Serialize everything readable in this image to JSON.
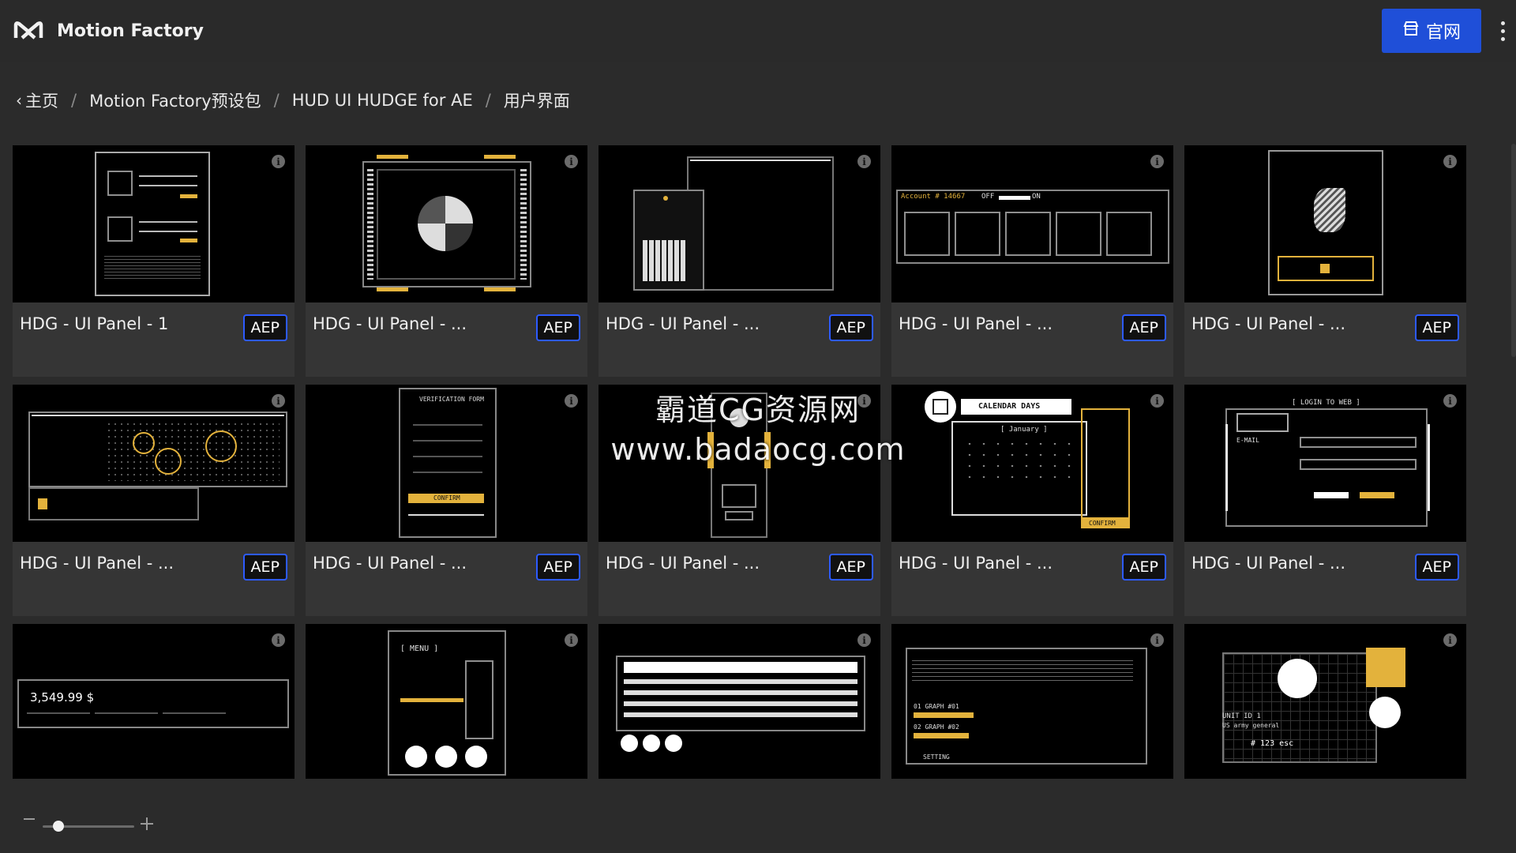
{
  "app": {
    "title": "Motion Factory"
  },
  "header": {
    "site_button_label": "官网"
  },
  "breadcrumb": {
    "items": [
      "主页",
      "Motion Factory预设包",
      "HUD UI HUDGE for AE",
      "用户界面"
    ]
  },
  "cards": [
    {
      "title": "HDG - UI Panel - 1",
      "badge": "AEP"
    },
    {
      "title": "HDG - UI Panel - ...",
      "badge": "AEP"
    },
    {
      "title": "HDG - UI Panel - ...",
      "badge": "AEP"
    },
    {
      "title": "HDG - UI Panel - ...",
      "badge": "AEP"
    },
    {
      "title": "HDG - UI Panel - ...",
      "badge": "AEP"
    },
    {
      "title": "HDG - UI Panel - ...",
      "badge": "AEP"
    },
    {
      "title": "HDG - UI Panel - ...",
      "badge": "AEP"
    },
    {
      "title": "HDG - UI Panel - ...",
      "badge": "AEP"
    },
    {
      "title": "HDG - UI Panel - ...",
      "badge": "AEP"
    },
    {
      "title": "HDG - UI Panel - ...",
      "badge": "AEP"
    }
  ],
  "thumb_text": {
    "account": "Account # 14667",
    "off": "OFF",
    "on": "ON",
    "verification": "VERIFICATION FORM",
    "confirm": "CONFIRM",
    "calendar_days": "CALENDAR DAYS",
    "january": "[ January ]",
    "login_to_web": "[   LOGIN TO WEB   ]",
    "email": "E-MAIL",
    "payment": "3,549.99  $",
    "menu": "[ MENU ]",
    "unit": "UNIT ID 1",
    "unit_sub": "US army general",
    "esc": "# 123 esc",
    "graph1": "01 GRAPH #01",
    "graph2": "02 GRAPH #02",
    "setting": "SETTING",
    "info_glyph": "i"
  },
  "watermark": {
    "line1": "霸道CG资源网",
    "line2": "www.badaocg.com"
  },
  "colors": {
    "accent": "#1f4fd8",
    "badge_border": "#2d5bff",
    "hud_gold": "#e3b23c"
  },
  "zoom": {
    "level": 0.17
  }
}
